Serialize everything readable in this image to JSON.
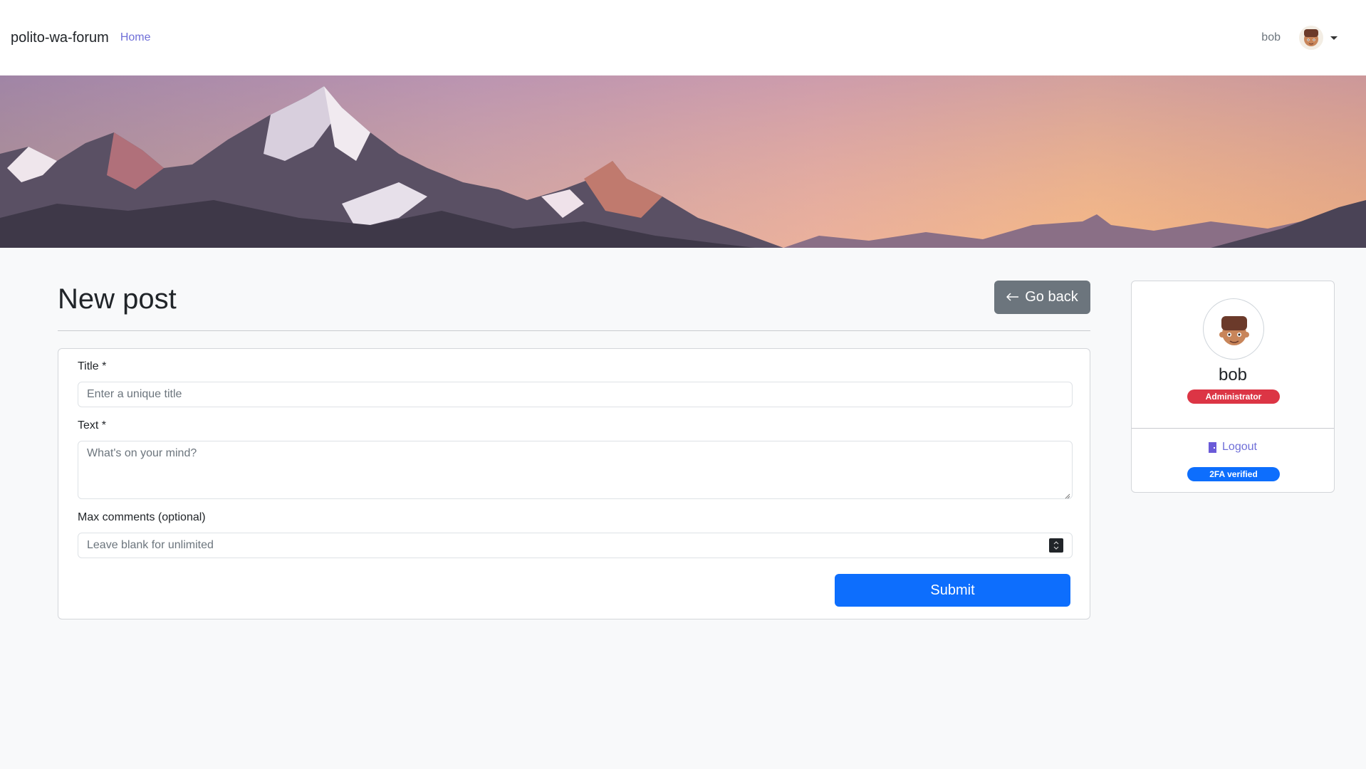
{
  "navbar": {
    "brand": "polito-wa-forum",
    "home_link": "Home",
    "username": "bob"
  },
  "page": {
    "title": "New post",
    "go_back_label": "Go back",
    "go_back_icon": "arrow-left-icon"
  },
  "form": {
    "title_label": "Title *",
    "title_placeholder": "Enter a unique title",
    "text_label": "Text *",
    "text_placeholder": "What's on your mind?",
    "max_comments_label": "Max comments (optional)",
    "max_comments_placeholder": "Leave blank for unlimited",
    "submit_label": "Submit"
  },
  "profile": {
    "name": "bob",
    "role_badge": "Administrator",
    "logout_label": "Logout",
    "logout_icon": "door-icon",
    "twofa_badge": "2FA verified"
  },
  "colors": {
    "primary": "#0d6efd",
    "secondary": "#6c757d",
    "danger": "#dc3545",
    "link": "#6f6fd8"
  }
}
